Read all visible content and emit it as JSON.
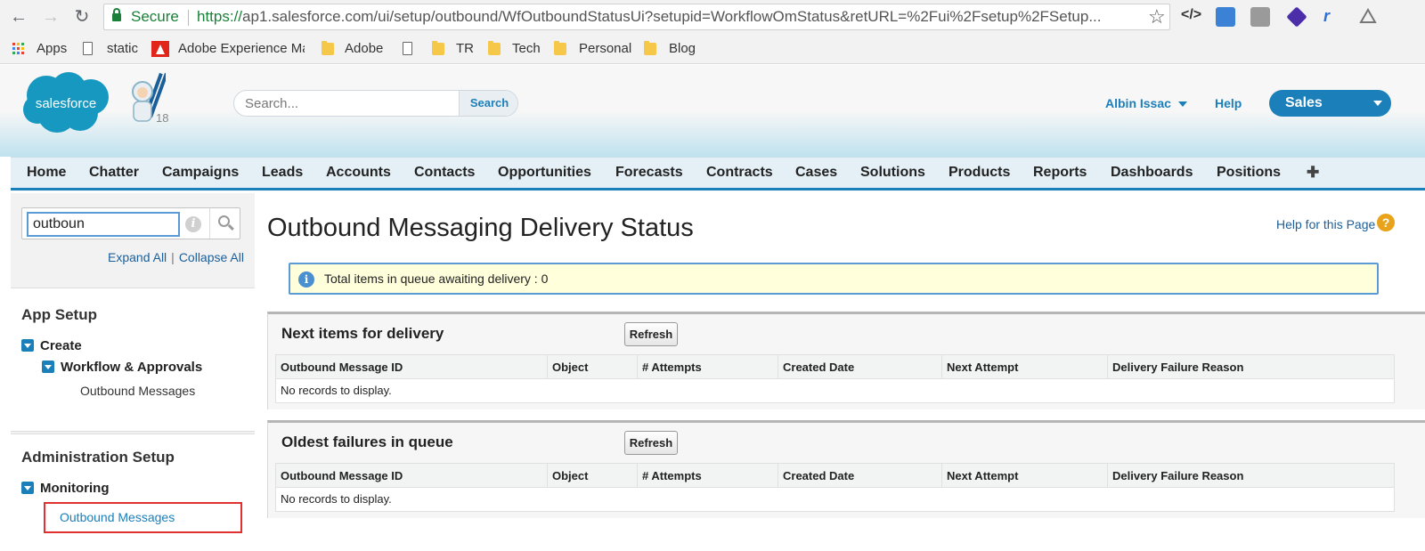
{
  "browser": {
    "secure_label": "Secure",
    "url_scheme": "https://",
    "url_rest": "ap1.salesforce.com/ui/setup/outbound/WfOutboundStatusUi?setupid=WorkflowOmStatus&retURL=%2Fui%2Fsetup%2FSetup...",
    "nav": {
      "back_icon": "back-arrow-icon",
      "forward_icon": "forward-arrow-icon",
      "reload_icon": "reload-icon"
    },
    "bookmarks": [
      {
        "label": "Apps",
        "icon": "apps-grid-icon"
      },
      {
        "label": "static",
        "icon": "page-icon"
      },
      {
        "label": "Adobe Experience Ma",
        "icon": "adobe-icon"
      },
      {
        "label": "Adobe",
        "icon": "folder-icon"
      },
      {
        "label": "",
        "icon": "page-icon"
      },
      {
        "label": "TR",
        "icon": "folder-icon"
      },
      {
        "label": "Tech",
        "icon": "folder-icon"
      },
      {
        "label": "Personal",
        "icon": "folder-icon"
      },
      {
        "label": "Blog",
        "icon": "folder-icon"
      }
    ]
  },
  "header": {
    "logo_text": "salesforce",
    "release_number": "18",
    "search_placeholder": "Search...",
    "search_button": "Search",
    "user_name": "Albin Issac",
    "help_label": "Help",
    "app_name": "Sales",
    "brand_color": "#1b7fba"
  },
  "tabs": [
    "Home",
    "Chatter",
    "Campaigns",
    "Leads",
    "Accounts",
    "Contacts",
    "Opportunities",
    "Forecasts",
    "Contracts",
    "Cases",
    "Solutions",
    "Products",
    "Reports",
    "Dashboards",
    "Positions",
    "✚"
  ],
  "sidebar": {
    "quick_find_value": "outboun",
    "expand_all": "Expand All",
    "collapse_all": "Collapse All",
    "separator": "|",
    "app_setup": {
      "heading": "App Setup",
      "create": "Create",
      "workflow": "Workflow & Approvals",
      "leaf": "Outbound Messages"
    },
    "admin_setup": {
      "heading": "Administration Setup",
      "monitoring": "Monitoring",
      "leaf": "Outbound Messages"
    }
  },
  "main": {
    "title": "Outbound Messaging Delivery Status",
    "help_link": "Help for this Page",
    "banner": "Total items in queue awaiting delivery : 0",
    "columns": [
      "Outbound Message ID",
      "Object",
      "# Attempts",
      "Created Date",
      "Next Attempt",
      "Delivery Failure Reason"
    ],
    "sections": [
      {
        "title": "Next items for delivery",
        "refresh": "Refresh",
        "empty": "No records to display."
      },
      {
        "title": "Oldest failures in queue",
        "refresh": "Refresh",
        "empty": "No records to display."
      }
    ]
  }
}
